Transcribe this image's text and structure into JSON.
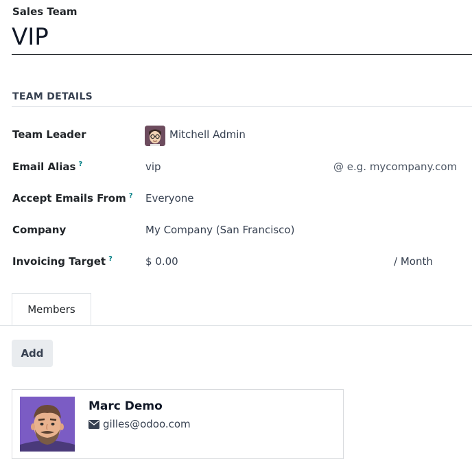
{
  "header": {
    "model_label": "Sales Team",
    "team_name": "VIP"
  },
  "section": {
    "title": "TEAM DETAILS"
  },
  "fields": {
    "team_leader": {
      "label": "Team Leader",
      "value": "Mitchell Admin",
      "avatar_icon": "user-avatar-icon"
    },
    "email_alias": {
      "label": "Email Alias",
      "help": "?",
      "value": "vip",
      "domain_placeholder": "@ e.g. mycompany.com"
    },
    "accept_emails": {
      "label": "Accept Emails From",
      "help": "?",
      "value": "Everyone"
    },
    "company": {
      "label": "Company",
      "value": "My Company (San Francisco)"
    },
    "invoicing_target": {
      "label": "Invoicing Target",
      "help": "?",
      "value": "$ 0.00",
      "suffix": "/ Month"
    }
  },
  "tabs": [
    {
      "label": "Members",
      "active": true
    }
  ],
  "members": {
    "add_label": "Add",
    "items": [
      {
        "name": "Marc Demo",
        "email": "gilles@odoo.com",
        "avatar_icon": "member-avatar-icon",
        "email_icon": "envelope-icon"
      }
    ]
  },
  "colors": {
    "help_accent": "#017e84",
    "avatar_bg": "#7b5cc4"
  }
}
